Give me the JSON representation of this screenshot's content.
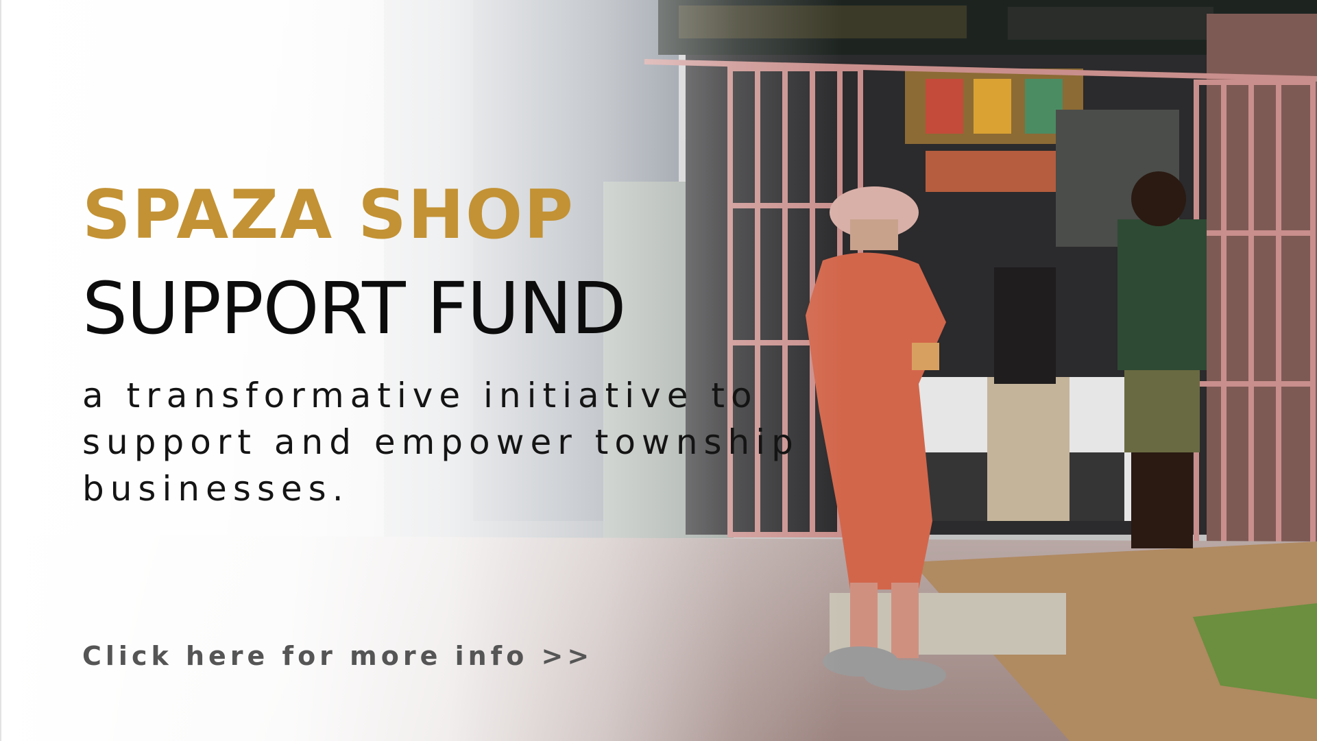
{
  "banner": {
    "title_accent": "SPAZA SHOP",
    "title_main": "SUPPORT FUND",
    "tagline": "a transformative initiative to support and empower township businesses.",
    "cta_label": "Click here for more info >>"
  },
  "colors": {
    "accent": "#c39234",
    "title": "#0c0c0c",
    "tagline": "#141414",
    "cta": "#555555"
  },
  "photo": {
    "description_icon": "street-storefront-photo"
  }
}
